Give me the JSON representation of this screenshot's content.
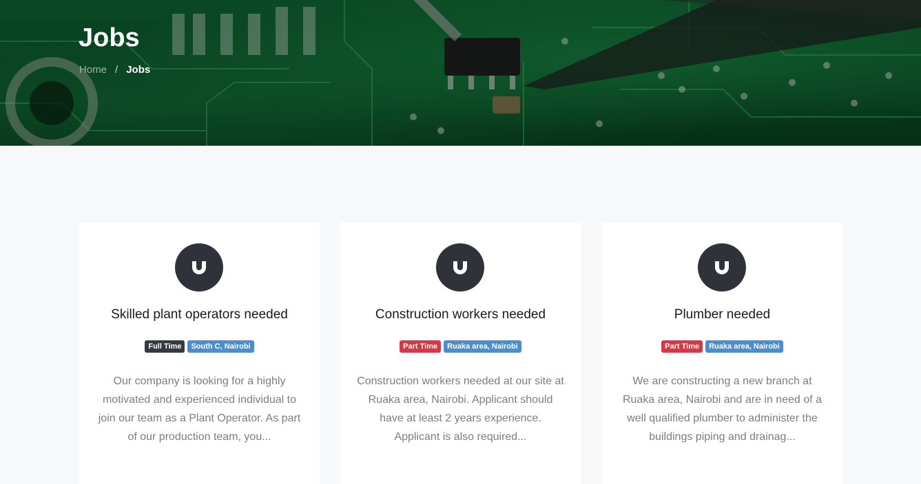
{
  "header": {
    "title": "Jobs",
    "breadcrumb": {
      "home": "Home",
      "separator": "/",
      "current": "Jobs"
    }
  },
  "jobs": [
    {
      "title": "Skilled plant operators needed",
      "type": "Full Time",
      "type_color": "#343a40",
      "location": "South C, Nairobi",
      "description": "Our company is looking for a highly motivated and experienced individual to join our team as a Plant Operator. As part of our production team, you..."
    },
    {
      "title": "Construction workers needed",
      "type": "Part Time",
      "type_color": "#dc3545",
      "location": "Ruaka area, Nairobi",
      "description": "Construction workers needed at our site at Ruaka area, Nairobi. Applicant should have at least 2 years experience. Applicant is also required..."
    },
    {
      "title": "Plumber needed",
      "type": "Part Time",
      "type_color": "#dc3545",
      "location": "Ruaka area, Nairobi",
      "description": "We are constructing a new branch at Ruaka area, Nairobi and are in need of a well qualified plumber to administer the buildings piping and drainag..."
    }
  ],
  "colors": {
    "location_badge": "#4a8ed0",
    "logo_bg": "#2f3238",
    "page_bg": "#f7f8fa"
  }
}
